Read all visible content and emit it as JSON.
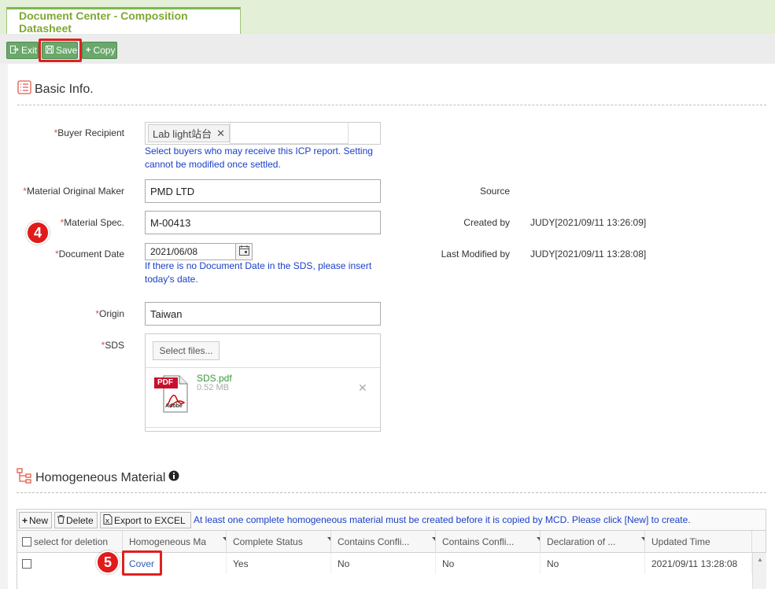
{
  "tab": {
    "title": "Document Center - Composition Datasheet"
  },
  "toolbar": {
    "exit_label": "Exit",
    "save_label": "Save",
    "copy_label": "Copy"
  },
  "basic_info": {
    "title": "Basic Info.",
    "buyer_recipient": {
      "label": "Buyer Recipient",
      "tag": "Lab light站台",
      "hint_line1": "Select buyers who may receive this ICP report. Setting",
      "hint_line2": "cannot be modified once settled."
    },
    "material_original_maker": {
      "label": "Material Original Maker",
      "value": "PMD LTD"
    },
    "material_spec": {
      "label": "Material Spec.",
      "value": "M-00413"
    },
    "document_date": {
      "label": "Document Date",
      "value": "2021/06/08",
      "hint_line1": "If there is no Document Date in the SDS, please insert",
      "hint_line2": "today's date."
    },
    "origin": {
      "label": "Origin",
      "value": "Taiwan"
    },
    "sds": {
      "label": "SDS",
      "select_label": "Select files...",
      "file_name": "SDS.pdf",
      "file_size": "0.52 MB",
      "file_badge": "PDF",
      "file_brand": "Adobe"
    },
    "required_mark": "*",
    "source": {
      "label": "Source",
      "value": ""
    },
    "created_by": {
      "label": "Created by",
      "value": "JUDY[2021/09/11 13:26:09]"
    },
    "last_modified_by": {
      "label": "Last Modified by",
      "value": "JUDY[2021/09/11 13:28:08]"
    }
  },
  "markers": {
    "step4": "4",
    "step5": "5"
  },
  "homogeneous": {
    "title": "Homogeneous Material",
    "new_label": "New",
    "delete_label": "Delete",
    "export_label": "Export to EXCEL",
    "notice": "At least one complete homogeneous material must be created before it is copied by MCD. Please click [New] to create.",
    "columns": [
      "select for deletion",
      "Homogeneous Ma",
      "Complete Status",
      "Contains Confli...",
      "Contains Confli...",
      "Declaration of ...",
      "Updated Time"
    ],
    "rows": [
      {
        "name": "Cover",
        "complete_status": "Yes",
        "contains_conflict_1": "No",
        "contains_conflict_2": "No",
        "declaration": "No",
        "updated_time": "2021/09/11 13:28:08"
      }
    ]
  },
  "colors": {
    "accent_green": "#6aa86b",
    "tab_text": "#7fa832",
    "hint_blue": "#1a3fc8",
    "required_red": "#d9534f",
    "highlight_red": "#e02020"
  }
}
